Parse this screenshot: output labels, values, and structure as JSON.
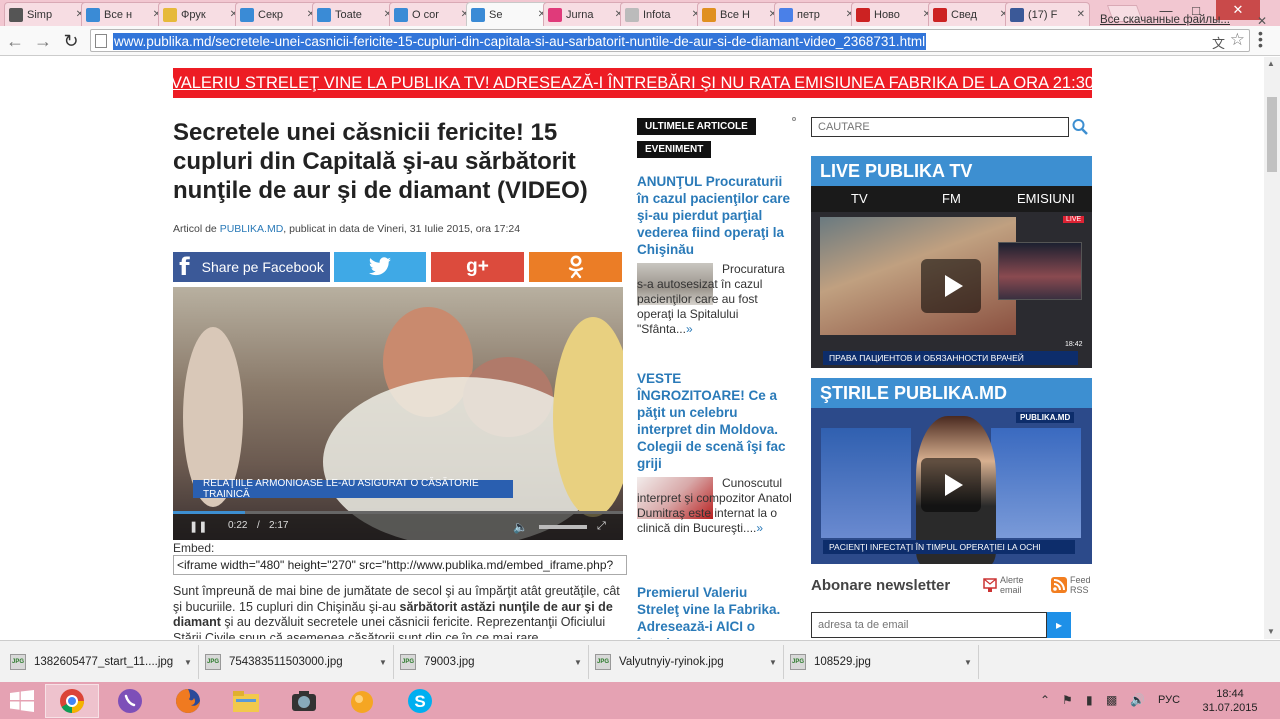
{
  "browser": {
    "tabs": [
      {
        "title": "Simp",
        "favicon": "s-icon",
        "color": "#555555"
      },
      {
        "title": "Все н",
        "favicon": "doc-icon",
        "color": "#3a8bd6"
      },
      {
        "title": "Фрук",
        "favicon": "bookmark-icon",
        "color": "#e6b93a"
      },
      {
        "title": "Секр",
        "favicon": "doc-icon",
        "color": "#3a8bd6"
      },
      {
        "title": "Toate",
        "favicon": "doc-icon",
        "color": "#3a8bd6"
      },
      {
        "title": "O cor",
        "favicon": "doc-icon",
        "color": "#3a8bd6"
      },
      {
        "title": "Se",
        "favicon": "doc-icon",
        "color": "#3a8bd6",
        "active": true
      },
      {
        "title": "Jurna",
        "favicon": "j-icon",
        "color": "#e03a7a"
      },
      {
        "title": "Infota",
        "favicon": "page-icon",
        "color": "#bbbbbb"
      },
      {
        "title": "Все Н",
        "favicon": "cross-icon",
        "color": "#e09020"
      },
      {
        "title": "петр",
        "favicon": "g-icon",
        "color": "#4a80e8"
      },
      {
        "title": "Ново",
        "favicon": "y-icon",
        "color": "#cc2222"
      },
      {
        "title": "Свед",
        "favicon": "y-icon",
        "color": "#cc2222"
      },
      {
        "title": "(17) F",
        "favicon": "facebook-icon",
        "color": "#3b5998"
      }
    ],
    "url": "www.publika.md/secretele-unei-casnicii-fericite-15-cupluri-din-capitala-si-au-sarbatorit-nuntile-de-aur-si-de-diamant-video_2368731.html"
  },
  "page": {
    "promo_banner": "VALERIU STRELEŢ VINE LA PUBLIKA TV! ADRESEAZĂ-I ÎNTREBĂRI ŞI NU RATA EMISIUNEA FABRIKA DE LA ORA 21:30",
    "headline": "Secretele unei căsnicii fericite! 15 cupluri din Capitală şi-au sărbătorit nunţile de aur şi de diamant (VIDEO)",
    "byline": {
      "prefix": "Articol de ",
      "source": "PUBLIKA.MD",
      "suffix": ", publicat in data de Vineri, 31 Iulie 2015, ora 17:24"
    },
    "share": {
      "facebook_label": "Share pe Facebook",
      "twitter_glyph": "🐦",
      "gplus_glyph": "g+",
      "ok_glyph": "ок"
    },
    "video": {
      "lower_third": "RELAŢIILE ARMONIOASE LE-AU ASIGURAT O CĂSĂTORIE TRAINICĂ",
      "current_time": "0:22",
      "separator": "/",
      "duration": "2:17",
      "progress": 0.16
    },
    "embed": {
      "label": "Embed:",
      "code": "<iframe width=\"480\" height=\"270\" src=\"http://www.publika.md/embed_iframe.php?"
    },
    "body": {
      "p1_a": "Sunt împreună de mai bine de jumătate de secol şi au împărţit atât greutăţile, cât şi bucuriile. 15 cupluri din Chişinău şi-au ",
      "p1_bold": "sărbătorit astăzi nunţile de aur şi de diamant",
      "p1_b": " şi au dezvăluit secretele unei căsnicii fericite. Reprezentanţii Oficiului Stării Civile spun că asemenea căsătorii sunt din ce în ce mai rare."
    },
    "middle": {
      "tag_latest": "ULTIMELE ARTICOLE",
      "tag_event": "EVENIMENT",
      "articles": [
        {
          "title": "ANUNŢUL Procuraturii în cazul pacienţilor care şi-au pierdut parţial vederea fiind operaţi la Chişinău",
          "excerpt": "Procuratura s-a autosesizat în cazul pacienţilor care au fost operaţi la Spitalului \"Sfânta...",
          "more": "»"
        },
        {
          "title": "VESTE ÎNGROZITOARE! Ce a păţit un celebru interpret din Moldova. Colegii de scenă îşi fac griji",
          "excerpt": "Cunoscutul interpret şi compozitor Anatol Dumitraş este internat la o clinică din Bucureşti....",
          "more": "»"
        },
        {
          "title": "Premierul Valeriu Streleţ vine la Fabrika. Adresează-i AICI o întrebare",
          "excerpt": "",
          "more": ""
        }
      ]
    },
    "right": {
      "search_placeholder": "CAUTARE",
      "live_title": "LIVE PUBLIKA TV",
      "live_tabs": [
        "TV",
        "FM",
        "EMISIUNI"
      ],
      "live_ticker": "ПРАВА ПАЦИЕНТОВ И ОБЯЗАННОСТИ ВРАЧЕЙ",
      "live_badge": "LIVE",
      "live_time": "18:42",
      "news_title": "ŞTIRILE PUBLIKA.MD",
      "news_logo": "PUBLIKA.MD",
      "news_ticker": "PACIENŢI INFECTAŢI ÎN TIMPUL OPERAŢIEI LA OCHI",
      "newsletter_title": "Abonare newsletter",
      "alert_email": "Alerte email",
      "feed_rss": "Feed RSS",
      "email_placeholder": "adresa ta de email",
      "submit_glyph": "▸"
    }
  },
  "downloads": {
    "items": [
      "1382605477_start_11....jpg",
      "754383511503000.jpg",
      "79003.jpg",
      "Valyutnyiy-ryinok.jpg",
      "108529.jpg"
    ],
    "show_all": "Все скачанные файлы...",
    "close_glyph": "✕"
  },
  "taskbar": {
    "apps": [
      "chrome-icon",
      "viber-icon",
      "firefox-icon",
      "file-explorer-icon",
      "camera-app-icon",
      "fruit-app-icon",
      "skype-icon"
    ],
    "lang": "РУС",
    "time": "18:44",
    "date": "31.07.2015"
  }
}
